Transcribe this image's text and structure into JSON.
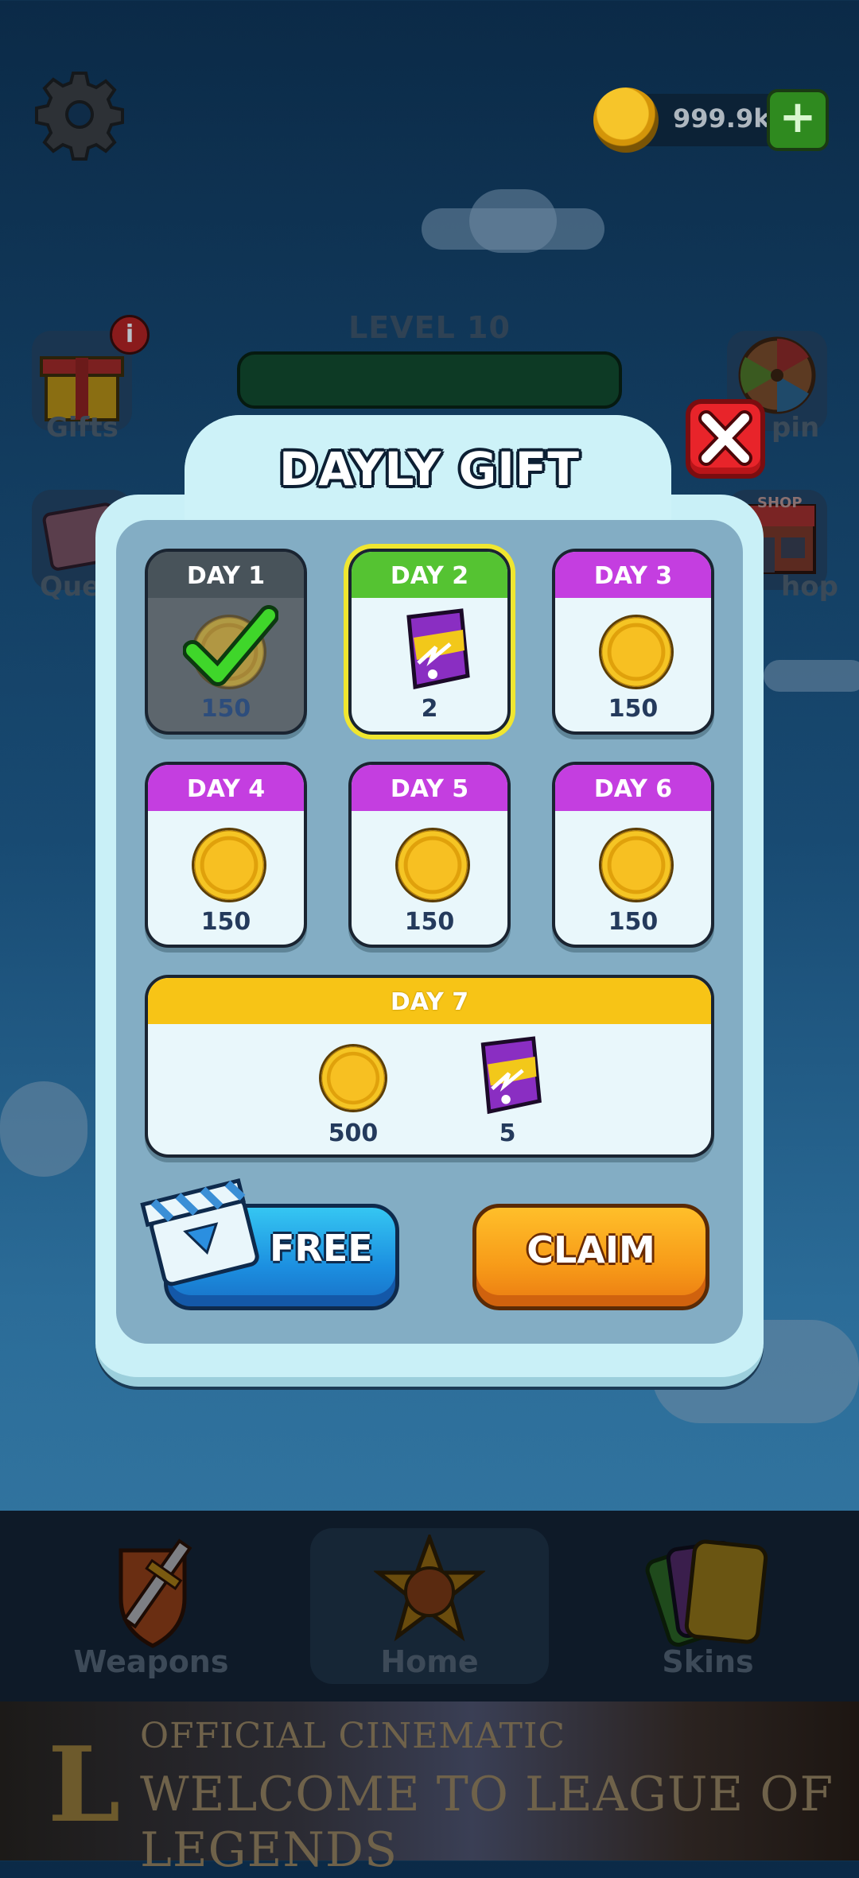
{
  "hud": {
    "coins": "999.9k",
    "level_label": "LEVEL 10",
    "level_progress": 0
  },
  "side_menu": {
    "left": [
      {
        "label": "Gifts",
        "badge": "i"
      },
      {
        "label": "Que"
      }
    ],
    "right": [
      {
        "label": "pin"
      },
      {
        "label": "hop",
        "sign": "SHOP"
      }
    ]
  },
  "bottom_nav": {
    "items": [
      {
        "label": "Weapons",
        "icon": "shield-sword-icon"
      },
      {
        "label": "Home",
        "icon": "star-icon",
        "active": true
      },
      {
        "label": "Skins",
        "icon": "cards-icon"
      }
    ]
  },
  "ad_banner": {
    "logo": "L",
    "line1": "OFFICIAL CINEMATIC",
    "line2": "WELCOME TO LEAGUE OF LEGENDS"
  },
  "modal": {
    "title": "DAYLY GIFT",
    "days": [
      {
        "label": "DAY 1",
        "amount": "150",
        "reward": "coin",
        "state": "claimed"
      },
      {
        "label": "DAY 2",
        "amount": "2",
        "reward": "card-pack",
        "state": "today"
      },
      {
        "label": "DAY 3",
        "amount": "150",
        "reward": "coin",
        "state": "locked"
      },
      {
        "label": "DAY 4",
        "amount": "150",
        "reward": "coin",
        "state": "locked"
      },
      {
        "label": "DAY 5",
        "amount": "150",
        "reward": "coin",
        "state": "locked"
      },
      {
        "label": "DAY 6",
        "amount": "150",
        "reward": "coin",
        "state": "locked"
      }
    ],
    "day7": {
      "label": "DAY 7",
      "rewards": [
        {
          "reward": "coin",
          "amount": "500"
        },
        {
          "reward": "card-pack",
          "amount": "5"
        }
      ]
    },
    "free_label": "FREE",
    "claim_label": "CLAIM"
  },
  "colors": {
    "header_purple": "#c43ee0",
    "header_green": "#55c332",
    "header_gold": "#f7c416",
    "claim_orange": "#f79a18",
    "free_blue": "#1c8fe0",
    "close_red": "#e8242a"
  }
}
